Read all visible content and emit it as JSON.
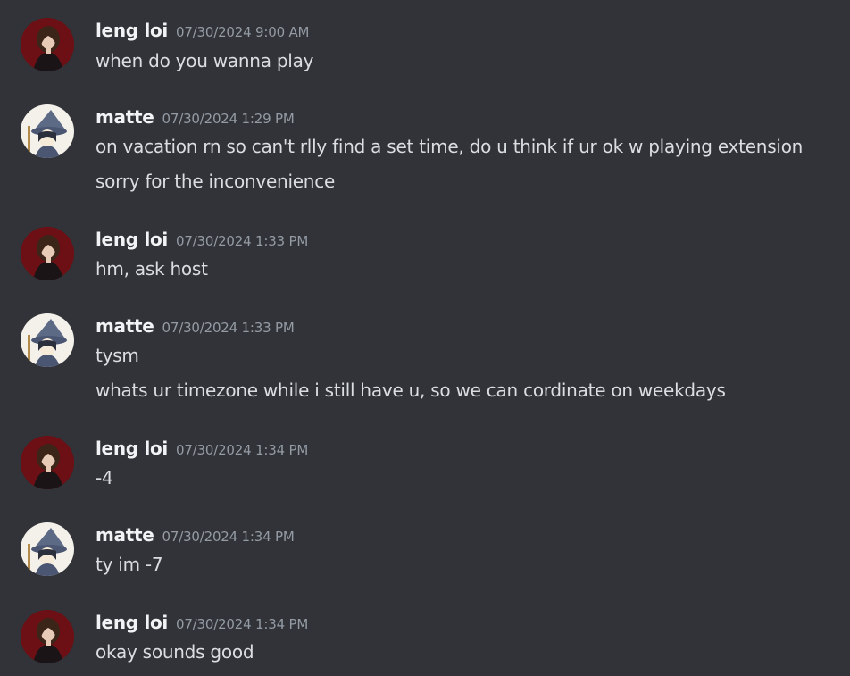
{
  "messages": [
    {
      "author": "leng loi",
      "avatar": "leng-loi-avatar",
      "time": "07/30/2024 9:00 AM",
      "lines": [
        "when do you wanna play"
      ]
    },
    {
      "author": "matte",
      "avatar": "matte-avatar",
      "time": "07/30/2024 1:29 PM",
      "lines": [
        "on vacation rn so can't rlly find a set time, do u think if ur ok w playing extension",
        "sorry for the inconvenience"
      ]
    },
    {
      "author": "leng loi",
      "avatar": "leng-loi-avatar",
      "time": "07/30/2024 1:33 PM",
      "lines": [
        "hm, ask host"
      ]
    },
    {
      "author": "matte",
      "avatar": "matte-avatar",
      "time": "07/30/2024 1:33 PM",
      "lines": [
        "tysm",
        "whats ur timezone while i still have u, so we can cordinate on weekdays"
      ]
    },
    {
      "author": "leng loi",
      "avatar": "leng-loi-avatar",
      "time": "07/30/2024 1:34 PM",
      "lines": [
        "-4"
      ]
    },
    {
      "author": "matte",
      "avatar": "matte-avatar",
      "time": "07/30/2024 1:34 PM",
      "lines": [
        "ty im -7"
      ]
    },
    {
      "author": "leng loi",
      "avatar": "leng-loi-avatar",
      "time": "07/30/2024 1:34 PM",
      "lines": [
        "okay sounds good"
      ]
    }
  ],
  "colors": {
    "background": "#313338",
    "username": "#f2f3f5",
    "timestamp": "#949ba4",
    "message_text": "#dbdee1"
  }
}
